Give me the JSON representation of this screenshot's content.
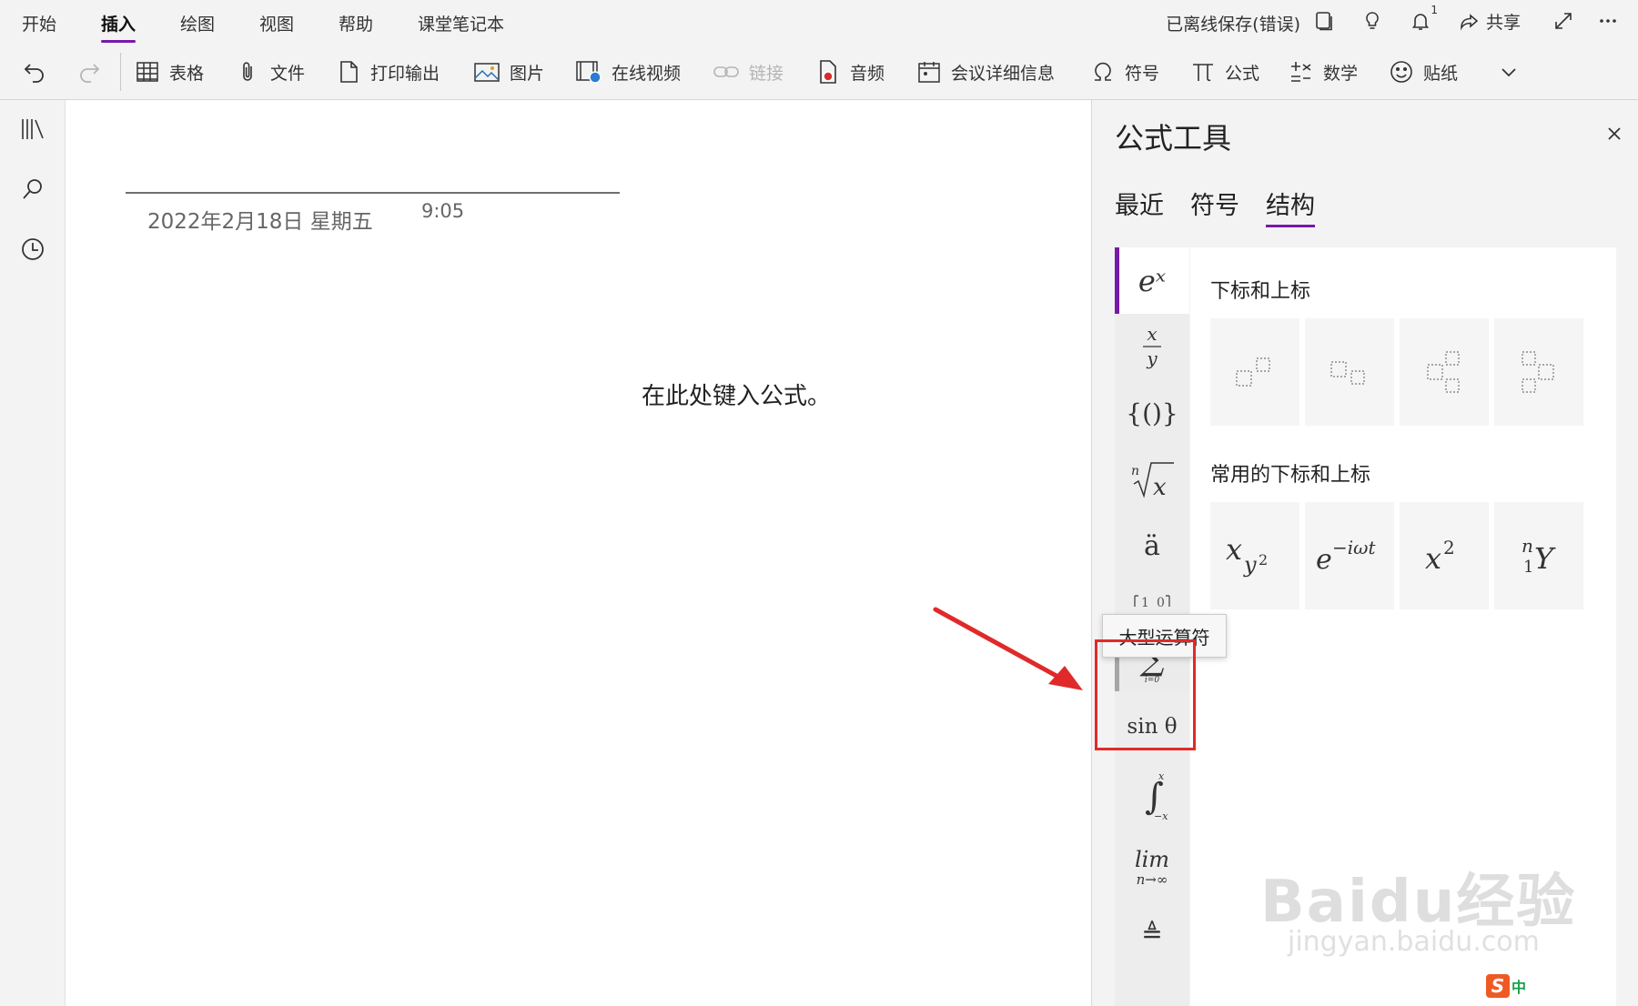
{
  "ribbon": {
    "tabs": [
      {
        "label": "开始"
      },
      {
        "label": "插入",
        "active": true
      },
      {
        "label": "绘图"
      },
      {
        "label": "视图"
      },
      {
        "label": "帮助"
      },
      {
        "label": "课堂笔记本"
      }
    ],
    "status": "已离线保存(错误)",
    "notification_count": "1",
    "share_label": "共享",
    "commands": {
      "table": "表格",
      "file": "文件",
      "printout": "打印输出",
      "picture": "图片",
      "online_video": "在线视频",
      "link": "链接",
      "audio": "音频",
      "meeting_details": "会议详细信息",
      "symbol": "符号",
      "equation": "公式",
      "math": "数学",
      "sticker": "贴纸"
    }
  },
  "note": {
    "date": "2022年2月18日 星期五",
    "time": "9:05",
    "equation_placeholder": "在此处键入公式。"
  },
  "equation_pane": {
    "title": "公式工具",
    "tabs": [
      {
        "label": "最近"
      },
      {
        "label": "符号"
      },
      {
        "label": "结构",
        "active": true
      }
    ],
    "categories": {
      "scripts": "eˣ",
      "bracket": "{()}",
      "accent": "ä",
      "function": "sin θ",
      "limit_top": "lim",
      "limit_bottom": "n→∞",
      "operator": "≜"
    },
    "tooltip": "大型运算符",
    "sections": {
      "scripts_heading": "下标和上标",
      "common_heading": "常用的下标和上标"
    }
  },
  "watermark": {
    "brand": "Baidu经验",
    "url": "jingyan.baidu.com"
  },
  "ime": {
    "logo": "S",
    "mode": "中"
  },
  "colors": {
    "accent": "#7719aa",
    "annotation_red": "#e02a2a",
    "ribbon_bg": "#f3f3f3"
  }
}
